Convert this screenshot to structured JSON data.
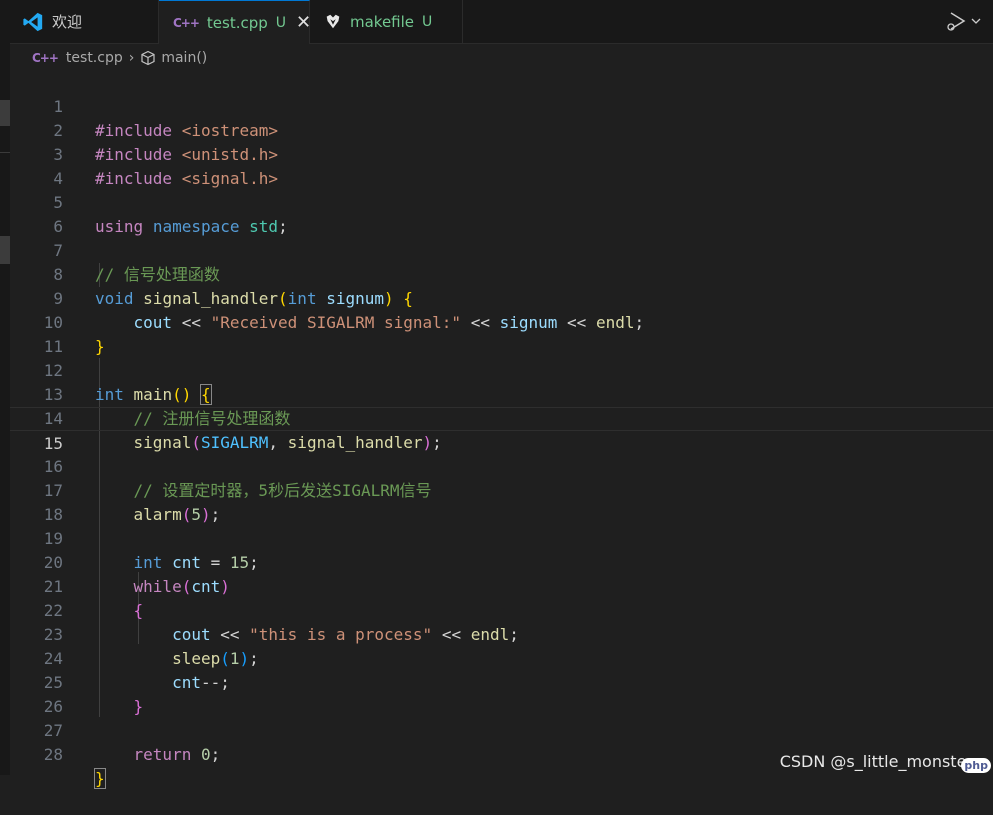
{
  "tabs": [
    {
      "label": "欢迎",
      "icon": "vscode-icon"
    },
    {
      "label": "test.cpp",
      "flag": "U",
      "icon": "cpp-file-icon",
      "active": true
    },
    {
      "label": "makefile",
      "flag": "U",
      "icon": "makefile-icon"
    }
  ],
  "breadcrumb": {
    "file": "test.cpp",
    "symbol": "main()"
  },
  "colors": {
    "accent": "#0078d4",
    "untracked": "#73c991"
  },
  "watermark": "CSDN @s_little_monster_",
  "badge": "php",
  "lines": [
    "1",
    "2",
    "3",
    "4",
    "5",
    "6",
    "7",
    "8",
    "9",
    "10",
    "11",
    "12",
    "13",
    "14",
    "15",
    "16",
    "17",
    "18",
    "19",
    "20",
    "21",
    "22",
    "23",
    "24",
    "25",
    "26",
    "27",
    "28"
  ],
  "current_line": 15,
  "code": {
    "l1": {
      "a": "#include ",
      "b": "<iostream>"
    },
    "l2": {
      "a": "#include ",
      "b": "<unistd.h>"
    },
    "l3": {
      "a": "#include ",
      "b": "<signal.h>"
    },
    "l5": {
      "a": "using",
      "b": "namespace",
      "c": "std"
    },
    "l7": "// 信号处理函数",
    "l8": {
      "kw": "void",
      "fn": "signal_handler",
      "pkw": "int",
      "pid": "signum"
    },
    "l9": {
      "id1": "cout",
      "str": "\"Received SIGALRM signal:\"",
      "id2": "signum",
      "id3": "endl"
    },
    "l12": {
      "kw": "int",
      "fn": "main"
    },
    "l13": "// 注册信号处理函数",
    "l14": {
      "fn": "signal",
      "c": "SIGALRM",
      "fn2": "signal_handler"
    },
    "l16": "// 设置定时器，5秒后发送SIGALRM信号",
    "l17": {
      "fn": "alarm",
      "n": "5"
    },
    "l19": {
      "kw": "int",
      "id": "cnt",
      "n": "15"
    },
    "l20": {
      "kw": "while",
      "id": "cnt"
    },
    "l22": {
      "id1": "cout",
      "str": "\"this is a process\"",
      "id2": "endl"
    },
    "l23": {
      "fn": "sleep",
      "n": "1"
    },
    "l24": {
      "id": "cnt",
      "op": "--;"
    },
    "l27": {
      "kw": "return",
      "n": "0"
    }
  }
}
